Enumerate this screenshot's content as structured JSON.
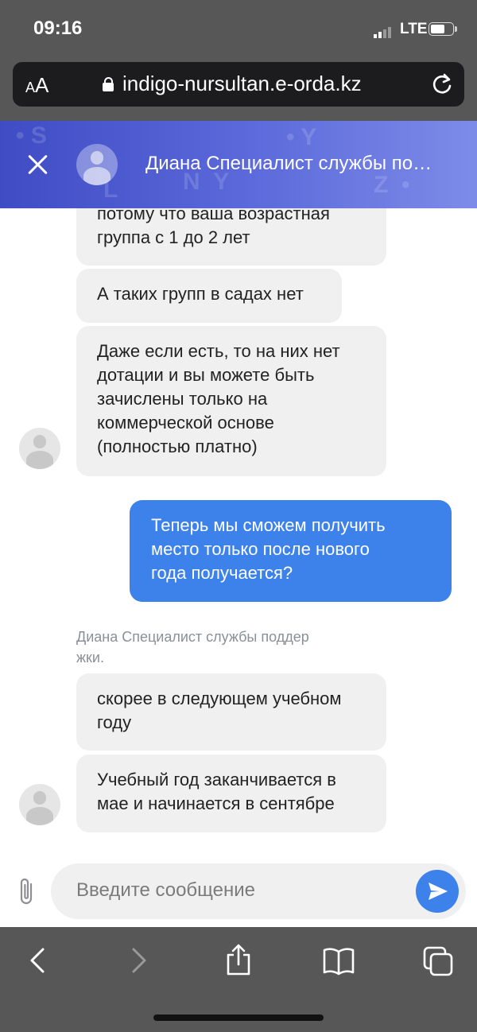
{
  "status_bar": {
    "time": "09:16",
    "network": "LTE"
  },
  "browser": {
    "text_size_button": "AA",
    "url": "indigo-nursultan.e-orda.kz"
  },
  "chat_header": {
    "title": "Диана Специалист службы по…",
    "accent_color": "#4a56cf"
  },
  "messages": [
    {
      "from": "agent",
      "text": "потому что ваша возрастная\nгруппа с 1 до 2 лет"
    },
    {
      "from": "agent",
      "text": "А таких групп в садах нет"
    },
    {
      "from": "agent",
      "text": "Даже если есть, то на них нет\nдотации и вы можете быть\nзачислены только на\nкоммерческой основе\n(полностью платно)"
    },
    {
      "from": "user",
      "text": "Теперь мы сможем получить\nместо только после нового\nгода получается?"
    },
    {
      "from": "agent",
      "text": "скорее в следующем учебном\nгоду"
    },
    {
      "from": "agent",
      "text": "Учебный год заканчивается в\nмае и начинается в сентябре"
    }
  ],
  "sender_label": "Диана Специалист службы поддер\nжки.",
  "composer": {
    "placeholder": "Введите сообщение",
    "send_color": "#3d82ea"
  },
  "toolbar": {
    "icons": [
      "back-icon",
      "forward-icon",
      "share-icon",
      "bookmarks-icon",
      "tabs-icon"
    ]
  }
}
